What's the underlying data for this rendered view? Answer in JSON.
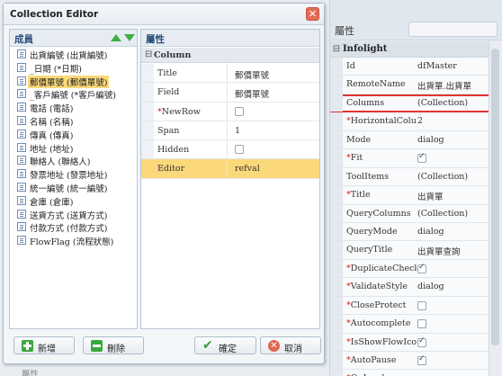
{
  "right_panel": {
    "header_label": "屬性",
    "section_title": "Infolight",
    "section_toggle": "⊟",
    "rows": [
      {
        "name": "Id",
        "required": false,
        "value": "dfMaster",
        "checkbox": null
      },
      {
        "name": "RemoteName",
        "required": false,
        "value": "出貨單.出貨單",
        "checkbox": null
      },
      {
        "name": "Columns",
        "required": false,
        "value": "(Collection)",
        "checkbox": null,
        "highlighted": true
      },
      {
        "name": "HorizontalColumn",
        "required": true,
        "value": "2",
        "checkbox": null
      },
      {
        "name": "Mode",
        "required": false,
        "value": "dialog",
        "checkbox": null
      },
      {
        "name": "Fit",
        "required": true,
        "value": "",
        "checkbox": true
      },
      {
        "name": "ToolItems",
        "required": false,
        "value": "(Collection)",
        "checkbox": null
      },
      {
        "name": "Title",
        "required": true,
        "value": "出貨單",
        "checkbox": null
      },
      {
        "name": "QueryColumns",
        "required": false,
        "value": "(Collection)",
        "checkbox": null
      },
      {
        "name": "QueryMode",
        "required": false,
        "value": "dialog",
        "checkbox": null
      },
      {
        "name": "QueryTitle",
        "required": false,
        "value": "出貨單查詢",
        "checkbox": null
      },
      {
        "name": "DuplicateCheck",
        "required": true,
        "value": "",
        "checkbox": true
      },
      {
        "name": "ValidateStyle",
        "required": true,
        "value": "dialog",
        "checkbox": null
      },
      {
        "name": "CloseProtect",
        "required": true,
        "value": "",
        "checkbox": false
      },
      {
        "name": "Autocomplete",
        "required": true,
        "value": "",
        "checkbox": false
      },
      {
        "name": "IsShowFlowIcon",
        "required": true,
        "value": "",
        "checkbox": true
      },
      {
        "name": "AutoPause",
        "required": true,
        "value": "",
        "checkbox": true
      },
      {
        "name": "OnLoad",
        "required": true,
        "value": "",
        "checkbox": null
      }
    ]
  },
  "dialog": {
    "title": "Collection Editor",
    "close_glyph": "✕",
    "members_label": "成員",
    "properties_label": "屬性",
    "members": [
      "出貨編號 (出貨編號)",
      "_日期 (*日期)",
      "郵價單號 (郵價單號)",
      "_客戶編號 (*客戶編號)",
      "電話 (電話)",
      "名稱 (名稱)",
      "傳真 (傳真)",
      "地址 (地址)",
      "聯絡人 (聯絡人)",
      "發票地址 (發票地址)",
      "統一編號 (統一編號)",
      "倉庫 (倉庫)",
      "送貨方式 (送貨方式)",
      "付款方式 (付款方式)",
      "FlowFlag (流程狀態)"
    ],
    "selected_member_index": 2,
    "props_section": "Column",
    "props_section_toggle": "⊟",
    "props": [
      {
        "name": "Title",
        "required": false,
        "value": "郵價單號",
        "checkbox": null
      },
      {
        "name": "Field",
        "required": false,
        "value": "郵價單號",
        "checkbox": null
      },
      {
        "name": "NewRow",
        "required": true,
        "value": "",
        "checkbox": false
      },
      {
        "name": "Span",
        "required": false,
        "value": "1",
        "checkbox": null
      },
      {
        "name": "Hidden",
        "required": false,
        "value": "",
        "checkbox": false
      },
      {
        "name": "Editor",
        "required": false,
        "value": "refval",
        "checkbox": null,
        "active": true
      }
    ],
    "buttons": {
      "add": "新增",
      "delete": "刪除",
      "ok": "確定",
      "cancel": "取消",
      "ok_glyph": "✔",
      "cancel_glyph": "✕"
    }
  },
  "footer_peek": "屬性",
  "colors": {
    "highlight_red": "#e3342f",
    "selection_yellow": "#fbd87a",
    "accent_green": "#3fae42"
  }
}
